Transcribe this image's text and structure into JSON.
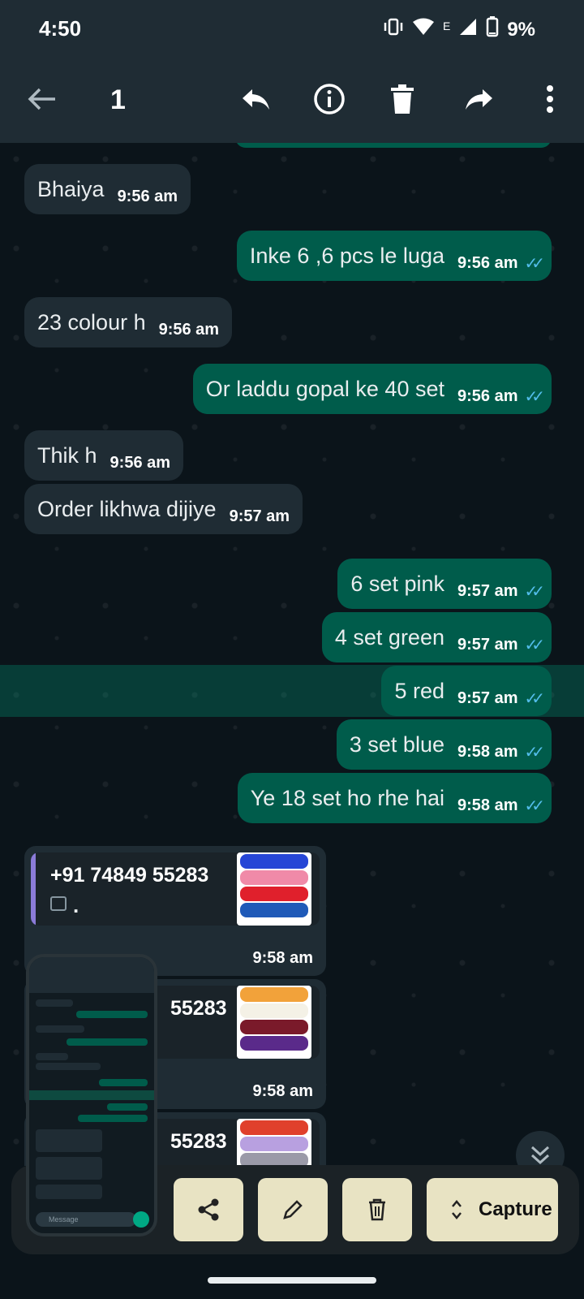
{
  "status": {
    "time": "4:50",
    "network": "E",
    "battery": "9%"
  },
  "appbar": {
    "selected_count": "1"
  },
  "messages": [
    {
      "dir": "in",
      "text": "Bhaiya",
      "time": "9:56 am"
    },
    {
      "dir": "out",
      "text": "Inke 6 ,6 pcs le luga",
      "time": "9:56 am"
    },
    {
      "dir": "in",
      "text": "23 colour h",
      "time": "9:56 am"
    },
    {
      "dir": "out",
      "text": "Or laddu gopal ke 40 set",
      "time": "9:56 am"
    },
    {
      "dir": "in",
      "text": "Thik h",
      "time": "9:56 am"
    },
    {
      "dir": "in",
      "text": "Order likhwa dijiye",
      "time": "9:57 am"
    },
    {
      "dir": "out",
      "text": "6 set pink",
      "time": "9:57 am"
    },
    {
      "dir": "out",
      "text": "4 set green",
      "time": "9:57 am"
    },
    {
      "dir": "out",
      "text": "5 red",
      "time": "9:57 am",
      "selected": true
    },
    {
      "dir": "out",
      "text": "3 set blue",
      "time": "9:58 am"
    },
    {
      "dir": "out",
      "text": "Ye 18 set ho rhe hai",
      "time": "9:58 am"
    }
  ],
  "replies": [
    {
      "phone": "+91 74849 55283",
      "quoted": ".",
      "body": ".",
      "time": "9:58 am"
    },
    {
      "phone": "55283",
      "time": "9:58 am"
    },
    {
      "phone": "55283"
    }
  ],
  "screenshot_toolbar": {
    "capture_label": "Capture"
  },
  "mini_preview": {
    "message_placeholder": "Message"
  }
}
